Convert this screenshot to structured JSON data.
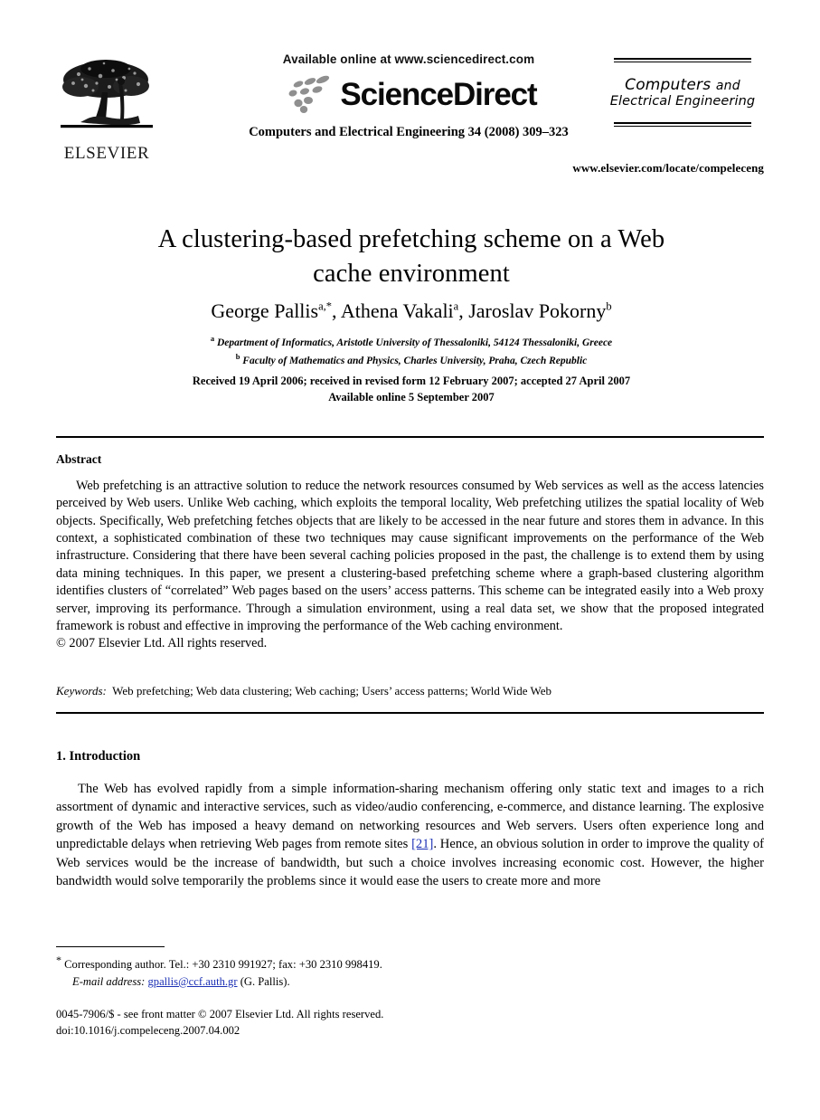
{
  "masthead": {
    "publisher_logo_text": "ELSEVIER",
    "publisher_logo_icon": "elsevier-tree-logo",
    "available_online": "Available online at www.sciencedirect.com",
    "sciencedirect_wordmark": "ScienceDirect",
    "sciencedirect_logo_icon": "sciencedirect-swoosh-dots-logo",
    "journal_citation_line": "Computers and Electrical Engineering 34 (2008) 309–323",
    "journal_logo_line1_main": "Computers",
    "journal_logo_line1_and": "and",
    "journal_logo_line2": "Electrical Engineering",
    "journal_url": "www.elsevier.com/locate/compeleceng"
  },
  "article": {
    "title_line1": "A clustering-based prefetching scheme on a Web",
    "title_line2": "cache environment",
    "authors_html_parts": {
      "author1": "George Pallis",
      "author1_sup": "a,*",
      "sep1": ", ",
      "author2": "Athena Vakali",
      "author2_sup": "a",
      "sep2": ", ",
      "author3": "Jaroslav Pokorny",
      "author3_sup": "b"
    },
    "affiliations": [
      {
        "marker": "a",
        "text": "Department of Informatics, Aristotle University of Thessaloniki, 54124 Thessaloniki, Greece"
      },
      {
        "marker": "b",
        "text": "Faculty of Mathematics and Physics, Charles University, Praha, Czech Republic"
      }
    ],
    "history_line1": "Received 19 April 2006; received in revised form 12 February 2007; accepted 27 April 2007",
    "history_line2": "Available online 5 September 2007"
  },
  "abstract": {
    "heading": "Abstract",
    "paragraph": "Web prefetching is an attractive solution to reduce the network resources consumed by Web services as well as the access latencies perceived by Web users. Unlike Web caching, which exploits the temporal locality, Web prefetching utilizes the spatial locality of Web objects. Specifically, Web prefetching fetches objects that are likely to be accessed in the near future and stores them in advance. In this context, a sophisticated combination of these two techniques may cause significant improvements on the performance of the Web infrastructure. Considering that there have been several caching policies proposed in the past, the challenge is to extend them by using data mining techniques. In this paper, we present a clustering-based prefetching scheme where a graph-based clustering algorithm identifies clusters of “correlated” Web pages based on the users’ access patterns. This scheme can be integrated easily into a Web proxy server, improving its performance. Through a simulation environment, using a real data set, we show that the proposed integrated framework is robust and effective in improving the performance of the Web caching environment.",
    "copyright": "© 2007 Elsevier Ltd. All rights reserved."
  },
  "keywords": {
    "label": "Keywords:",
    "value": "Web prefetching; Web data clustering; Web caching; Users’ access patterns; World Wide Web"
  },
  "section1": {
    "heading": "1. Introduction",
    "paragraph_part1": "The Web has evolved rapidly from a simple information-sharing mechanism offering only static text and images to a rich assortment of dynamic and interactive services, such as video/audio conferencing, e-commerce, and distance learning. The explosive growth of the Web has imposed a heavy demand on networking resources and Web servers. Users often experience long and unpredictable delays when retrieving Web pages from remote sites ",
    "citation": "[21]",
    "paragraph_part2": ". Hence, an obvious solution in order to improve the quality of Web services would be the increase of bandwidth, but such a choice involves increasing economic cost. However, the higher bandwidth would solve temporarily the problems since it would ease the users to create more and more"
  },
  "footnote": {
    "star": "*",
    "line1": "Corresponding author. Tel.: +30 2310 991927; fax: +30 2310 998419.",
    "email_label": "E-mail address:",
    "email": "gpallis@ccf.auth.gr",
    "email_owner": "(G. Pallis)."
  },
  "colophon": {
    "issn_line": "0045-7906/$ - see front matter © 2007 Elsevier Ltd. All rights reserved.",
    "doi_line": "doi:10.1016/j.compeleceng.2007.04.002"
  },
  "colors": {
    "link": "#1a2fb4",
    "text": "#000000",
    "logo_gray": "#8f8f8f",
    "background": "#ffffff"
  }
}
